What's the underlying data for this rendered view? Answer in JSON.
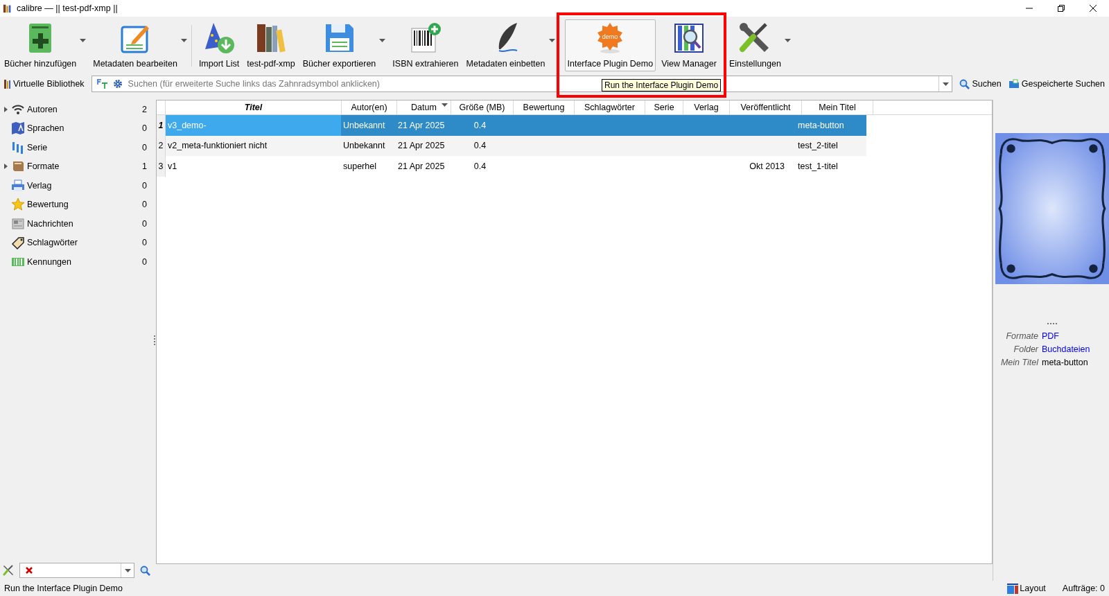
{
  "window": {
    "title": "calibre — || test-pdf-xmp ||"
  },
  "toolbar": [
    {
      "label": "Bücher hinzufügen",
      "dropdown": true,
      "selected": false
    },
    {
      "label": "Metadaten bearbeiten",
      "dropdown": true,
      "selected": false
    },
    {
      "label": "Import List",
      "dropdown": false,
      "selected": false
    },
    {
      "label": "test-pdf-xmp",
      "dropdown": false,
      "selected": false
    },
    {
      "label": "Bücher exportieren",
      "dropdown": true,
      "selected": false
    },
    {
      "label": "ISBN extrahieren",
      "dropdown": false,
      "selected": false
    },
    {
      "label": "Metadaten einbetten",
      "dropdown": true,
      "selected": false
    },
    {
      "label": "Interface Plugin Demo",
      "dropdown": false,
      "selected": true,
      "badge_text": "demo"
    },
    {
      "label": "View Manager",
      "dropdown": false,
      "selected": false
    },
    {
      "label": "Einstellungen",
      "dropdown": true,
      "selected": false
    }
  ],
  "tooltip": "Run the Interface Plugin Demo",
  "search_bar": {
    "virtual_library": "Virtuelle Bibliothek",
    "placeholder": "Suchen (für erweiterte Suche links das Zahnradsymbol anklicken)",
    "search_button": "Suchen",
    "saved_searches": "Gespeicherte Suchen"
  },
  "tag_browser": [
    {
      "name": "Autoren",
      "count": "2",
      "expandable": true
    },
    {
      "name": "Sprachen",
      "count": "0",
      "expandable": false
    },
    {
      "name": "Serie",
      "count": "0",
      "expandable": false
    },
    {
      "name": "Formate",
      "count": "1",
      "expandable": true
    },
    {
      "name": "Verlag",
      "count": "0",
      "expandable": false
    },
    {
      "name": "Bewertung",
      "count": "0",
      "expandable": false
    },
    {
      "name": "Nachrichten",
      "count": "0",
      "expandable": false
    },
    {
      "name": "Schlagwörter",
      "count": "0",
      "expandable": false
    },
    {
      "name": "Kennungen",
      "count": "0",
      "expandable": false
    }
  ],
  "table": {
    "columns": [
      {
        "label": "Titel",
        "emphasized": true,
        "sorted": false
      },
      {
        "label": "Autor(en)",
        "emphasized": false,
        "sorted": false
      },
      {
        "label": "Datum",
        "emphasized": false,
        "sorted": true
      },
      {
        "label": "Größe (MB)",
        "emphasized": false,
        "sorted": false
      },
      {
        "label": "Bewertung",
        "emphasized": false,
        "sorted": false
      },
      {
        "label": "Schlagwörter",
        "emphasized": false,
        "sorted": false
      },
      {
        "label": "Serie",
        "emphasized": false,
        "sorted": false
      },
      {
        "label": "Verlag",
        "emphasized": false,
        "sorted": false
      },
      {
        "label": "Veröffentlicht",
        "emphasized": false,
        "sorted": false
      },
      {
        "label": "Mein Titel",
        "emphasized": false,
        "sorted": false
      }
    ],
    "rows": [
      {
        "number": "1",
        "selected": true,
        "title": "v3_demo-",
        "authors": "Unbekannt",
        "date": "21 Apr 2025",
        "size": "0.4",
        "my_title": "meta-button"
      },
      {
        "number": "2",
        "selected": false,
        "title": "v2_meta-funktioniert nicht",
        "authors": "Unbekannt",
        "date": "21 Apr 2025",
        "size": "0.4",
        "my_title": "test_2-titel"
      },
      {
        "number": "3",
        "selected": false,
        "title": "v1",
        "authors": "superhel",
        "date": "21 Apr 2025",
        "size": "0.4",
        "published": "Okt 2013",
        "my_title": "test_1-titel"
      }
    ]
  },
  "book_details": [
    {
      "label": "Formate",
      "value": "PDF",
      "link": true
    },
    {
      "label": "Folder",
      "value": "Buchdateien",
      "link": true
    },
    {
      "label": "Mein Titel",
      "value": "meta-button",
      "link": false
    }
  ],
  "status_bar": {
    "message": "Run the Interface Plugin Demo",
    "layout": "Layout",
    "jobs": "Aufträge: 0"
  }
}
